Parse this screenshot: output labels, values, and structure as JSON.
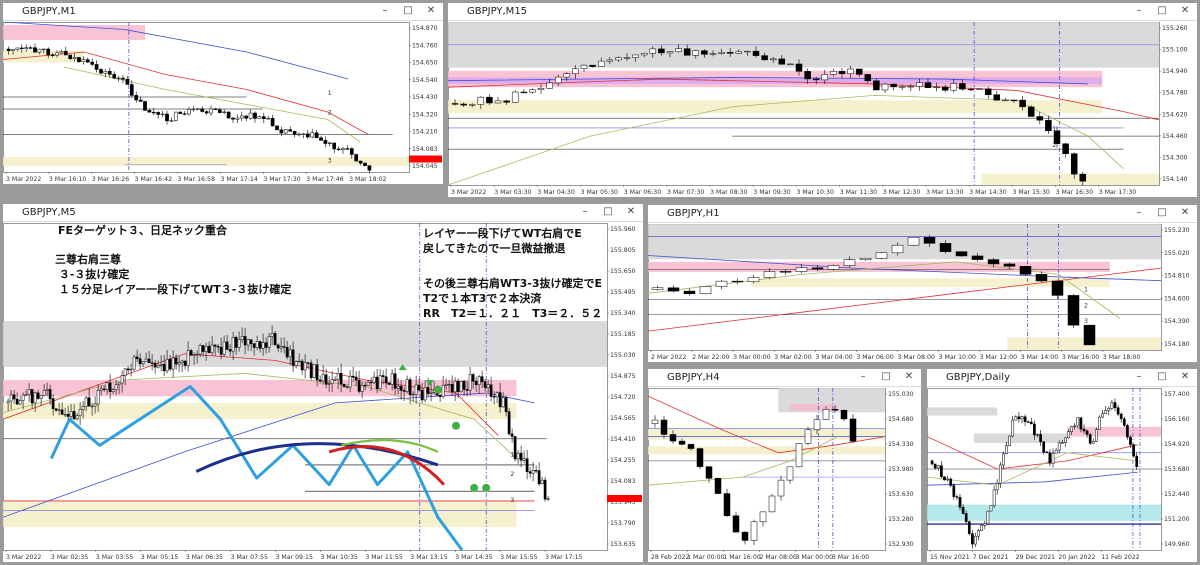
{
  "windows": [
    {
      "id": "m1",
      "title": "GBPJPY,M1",
      "price_labels": [
        "154.870",
        "154.760",
        "154.650",
        "154.540",
        "154.430",
        "154.320",
        "154.210",
        "154.083",
        "154.045"
      ],
      "time_labels": [
        "3 Mar 2022",
        "3 Mar 16:10",
        "3 Mar 16:26",
        "3 Mar 16:42",
        "3 Mar 16:58",
        "3 Mar 17:14",
        "3 Mar 17:30",
        "3 Mar 17:46",
        "3 Mar 18:02"
      ],
      "level_labels": [
        "1",
        "2",
        "3"
      ]
    },
    {
      "id": "m15",
      "title": "GBPJPY,M15",
      "price_labels": [
        "155.260",
        "155.100",
        "154.940",
        "154.780",
        "154.620",
        "154.460",
        "154.300",
        "154.140"
      ],
      "time_labels": [
        "3 Mar 2022",
        "3 Mar 03:30",
        "3 Mar 04:30",
        "3 Mar 05:30",
        "3 Mar 06:30",
        "3 Mar 07:30",
        "3 Mar 08:30",
        "3 Mar 09:30",
        "3 Mar 10:30",
        "3 Mar 11:30",
        "3 Mar 12:30",
        "3 Mar 13:30",
        "3 Mar 14:30",
        "3 Mar 15:30",
        "3 Mar 16:30",
        "3 Mar 17:30"
      ],
      "level_labels": [
        "1",
        "2"
      ]
    },
    {
      "id": "m5",
      "title": "GBPJPY,M5",
      "price_labels": [
        "155.960",
        "155.805",
        "155.650",
        "155.495",
        "155.340",
        "155.185",
        "155.030",
        "154.875",
        "154.720",
        "154.565",
        "154.410",
        "154.255",
        "154.083",
        "153.945",
        "153.790",
        "153.635"
      ],
      "time_labels": [
        "3 Mar 2022",
        "3 Mar 02:35",
        "3 Mar 03:55",
        "3 Mar 05:15",
        "3 Mar 06:35",
        "3 Mar 07:55",
        "3 Mar 09:15",
        "3 Mar 10:35",
        "3 Mar 11:55",
        "3 Mar 13:15",
        "3 Mar 14:35",
        "3 Mar 15:55",
        "3 Mar 17:15"
      ],
      "level_labels": [
        "1",
        "2",
        "3"
      ],
      "notes": {
        "left1": "FEターゲット３、日足ネック重合",
        "left2": "三尊右肩三尊\n ３-３抜け確定\n １５分足レイアー一段下げてWT３-３抜け確定",
        "right1": "レイヤー一段下げてWT右肩でE\n戻してきたので一旦微益撤退",
        "right2": "その後三尊右肩WT3-3抜け確定でE\nT2で１本T3で２本決済\nRR　T2＝１．２１　T3＝２．５２"
      }
    },
    {
      "id": "h1",
      "title": "GBPJPY,H1",
      "price_labels": [
        "155.230",
        "155.020",
        "154.810",
        "154.600",
        "154.390",
        "154.180"
      ],
      "time_labels": [
        "2 Mar 2022",
        "2 Mar 22:00",
        "3 Mar 00:00",
        "3 Mar 02:00",
        "3 Mar 04:00",
        "3 Mar 06:00",
        "3 Mar 08:00",
        "3 Mar 10:00",
        "3 Mar 12:00",
        "3 Mar 14:00",
        "3 Mar 16:00",
        "3 Mar 18:00"
      ],
      "level_labels": [
        "1",
        "2",
        "3"
      ]
    },
    {
      "id": "h4",
      "title": "GBPJPY,H4",
      "price_labels": [
        "155.030",
        "154.680",
        "154.330",
        "153.980",
        "153.630",
        "153.280",
        "152.930"
      ],
      "time_labels": [
        "28 Feb 2022",
        "1 Mar 00:00",
        "1 Mar 16:00",
        "2 Mar 08:00",
        "3 Mar 00:00",
        "3 Mar 16:00"
      ],
      "level_labels": []
    },
    {
      "id": "d1",
      "title": "GBPJPY,Daily",
      "price_labels": [
        "157.400",
        "156.160",
        "154.920",
        "153.680",
        "152.440",
        "151.200",
        "149.960"
      ],
      "time_labels": [
        "15 Nov 2021",
        "7 Dec 2021",
        "29 Dec 2021",
        "20 Jan 2022",
        "11 Feb 2022"
      ],
      "level_labels": []
    }
  ],
  "colors": {
    "bull": "#ffffff",
    "bear": "#000000",
    "zone_gray": "#d3d3d3",
    "zone_pink": "#f7b8cc",
    "zone_yellow": "#f3eec6",
    "zone_cyan": "#a8e6ea",
    "current": "#ff0000",
    "ma_red": "#e03030",
    "ma_blue": "#3f4fd6",
    "ma_olive": "#a8b860",
    "wt_blue": "#2f9fe0"
  },
  "window_buttons": {
    "minimize": "–",
    "maximize": "□",
    "close": "✕"
  }
}
